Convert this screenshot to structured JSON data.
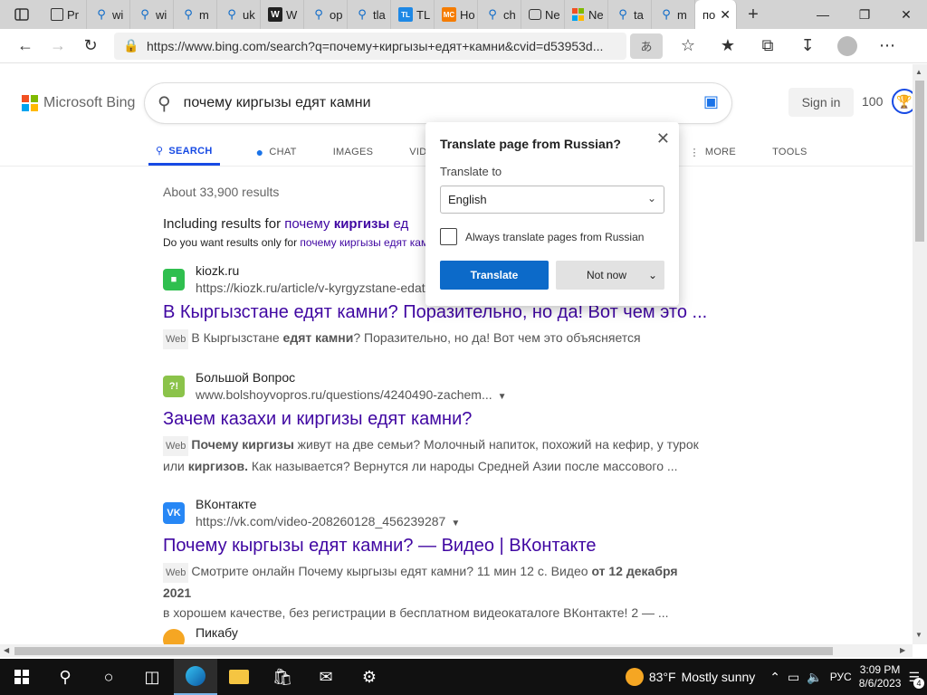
{
  "tabs": [
    {
      "icon": "sidebar-icon"
    },
    {
      "label": "Pr",
      "icon": "page-icon"
    },
    {
      "label": "wi",
      "icon": "search-icon"
    },
    {
      "label": "wi",
      "icon": "search-icon"
    },
    {
      "label": "m",
      "icon": "search-icon"
    },
    {
      "label": "uk",
      "icon": "search-icon"
    },
    {
      "label": "W",
      "icon": "wikipedia-icon",
      "favtext": "W"
    },
    {
      "label": "op",
      "icon": "search-icon"
    },
    {
      "label": "tla",
      "icon": "search-icon"
    },
    {
      "label": "TL",
      "icon": "tl-icon",
      "favtext": "TL"
    },
    {
      "label": "Ho",
      "icon": "mc-icon",
      "favtext": "MC"
    },
    {
      "label": "ch",
      "icon": "search-icon"
    },
    {
      "label": "Ne",
      "icon": "news-icon"
    },
    {
      "label": "Ne",
      "icon": "microsoft-icon"
    },
    {
      "label": "ta",
      "icon": "search-icon"
    },
    {
      "label": "m",
      "icon": "search-icon"
    },
    {
      "label": "по",
      "icon": "bing-icon"
    }
  ],
  "address": {
    "url": "https://www.bing.com/search?q=почему+киргызы+едят+камни&cvid=d53953d..."
  },
  "bing": {
    "logo_text": "Microsoft Bing",
    "query": "почему киргызы едят камни",
    "signin": "Sign in",
    "points": "100",
    "nav": [
      "SEARCH",
      "CHAT",
      "IMAGES",
      "VID",
      "MORE",
      "TOOLS"
    ],
    "results_count": "About 33,900 results",
    "including_prefix": "Including results for ",
    "including_link_a": "почему ",
    "including_link_b": "киргизы",
    "including_link_c": " ед",
    "doyou_prefix": "Do you want results only for ",
    "doyou_link": "почему киргызы едят камни",
    "doyou_suffix": "?"
  },
  "results": [
    {
      "site": "kiozk.ru",
      "url": "https://kiozk.ru/article/v-kyrgyzstane-edat-kamni...",
      "title": "В Кыргызстане едят камни? Поразительно, но да! Вот чем это ...",
      "badge": "Web",
      "snippet_a": "В Кыргызстане ",
      "snippet_b": "едят камни",
      "snippet_c": "? Поразительно, но да! Вот чем это объясняется",
      "fav_color": "#2fbf4f"
    },
    {
      "site": "Большой Вопрос",
      "url": "www.bolshoyvopros.ru/questions/4240490-zachem...",
      "title": "Зачем казахи и киргизы едят камни?",
      "badge": "Web",
      "snippet_a": "Почему киргизы",
      "snippet_b": " живут на две семьи? Молочный напиток, похожий на кефир, у турок",
      "snippet_c": "или ",
      "snippet_d": "киргизов.",
      "snippet_e": " Как называется? Вернутся ли народы Средней Азии после массового ...",
      "fav_color": "#8bc34a"
    },
    {
      "site": "ВКонтакте",
      "url": "https://vk.com/video-208260128_456239287",
      "title": "Почему кыргызы едят камни? — Видео | ВКонтакте",
      "badge": "Web",
      "snippet_a": "Смотрите онлайн Почему кыргызы едят камни? 11 мин 12 с. Видео ",
      "snippet_b": "от 12 декабря 2021",
      "snippet_c": "в хорошем качестве, без регистрации в бесплатном видеокаталоге ВКонтакте! 2 — ...",
      "fav_color": "#2787f5"
    },
    {
      "site": "Пикабу"
    }
  ],
  "translate_popup": {
    "title": "Translate page from Russian?",
    "label": "Translate to",
    "language": "English",
    "always": "Always translate pages from Russian",
    "translate_btn": "Translate",
    "not_now_btn": "Not now"
  },
  "taskbar": {
    "temperature": "83°F",
    "weather": "Mostly sunny",
    "language": "РУС",
    "time": "3:09 PM",
    "date": "8/6/2023",
    "notifications": "4"
  }
}
